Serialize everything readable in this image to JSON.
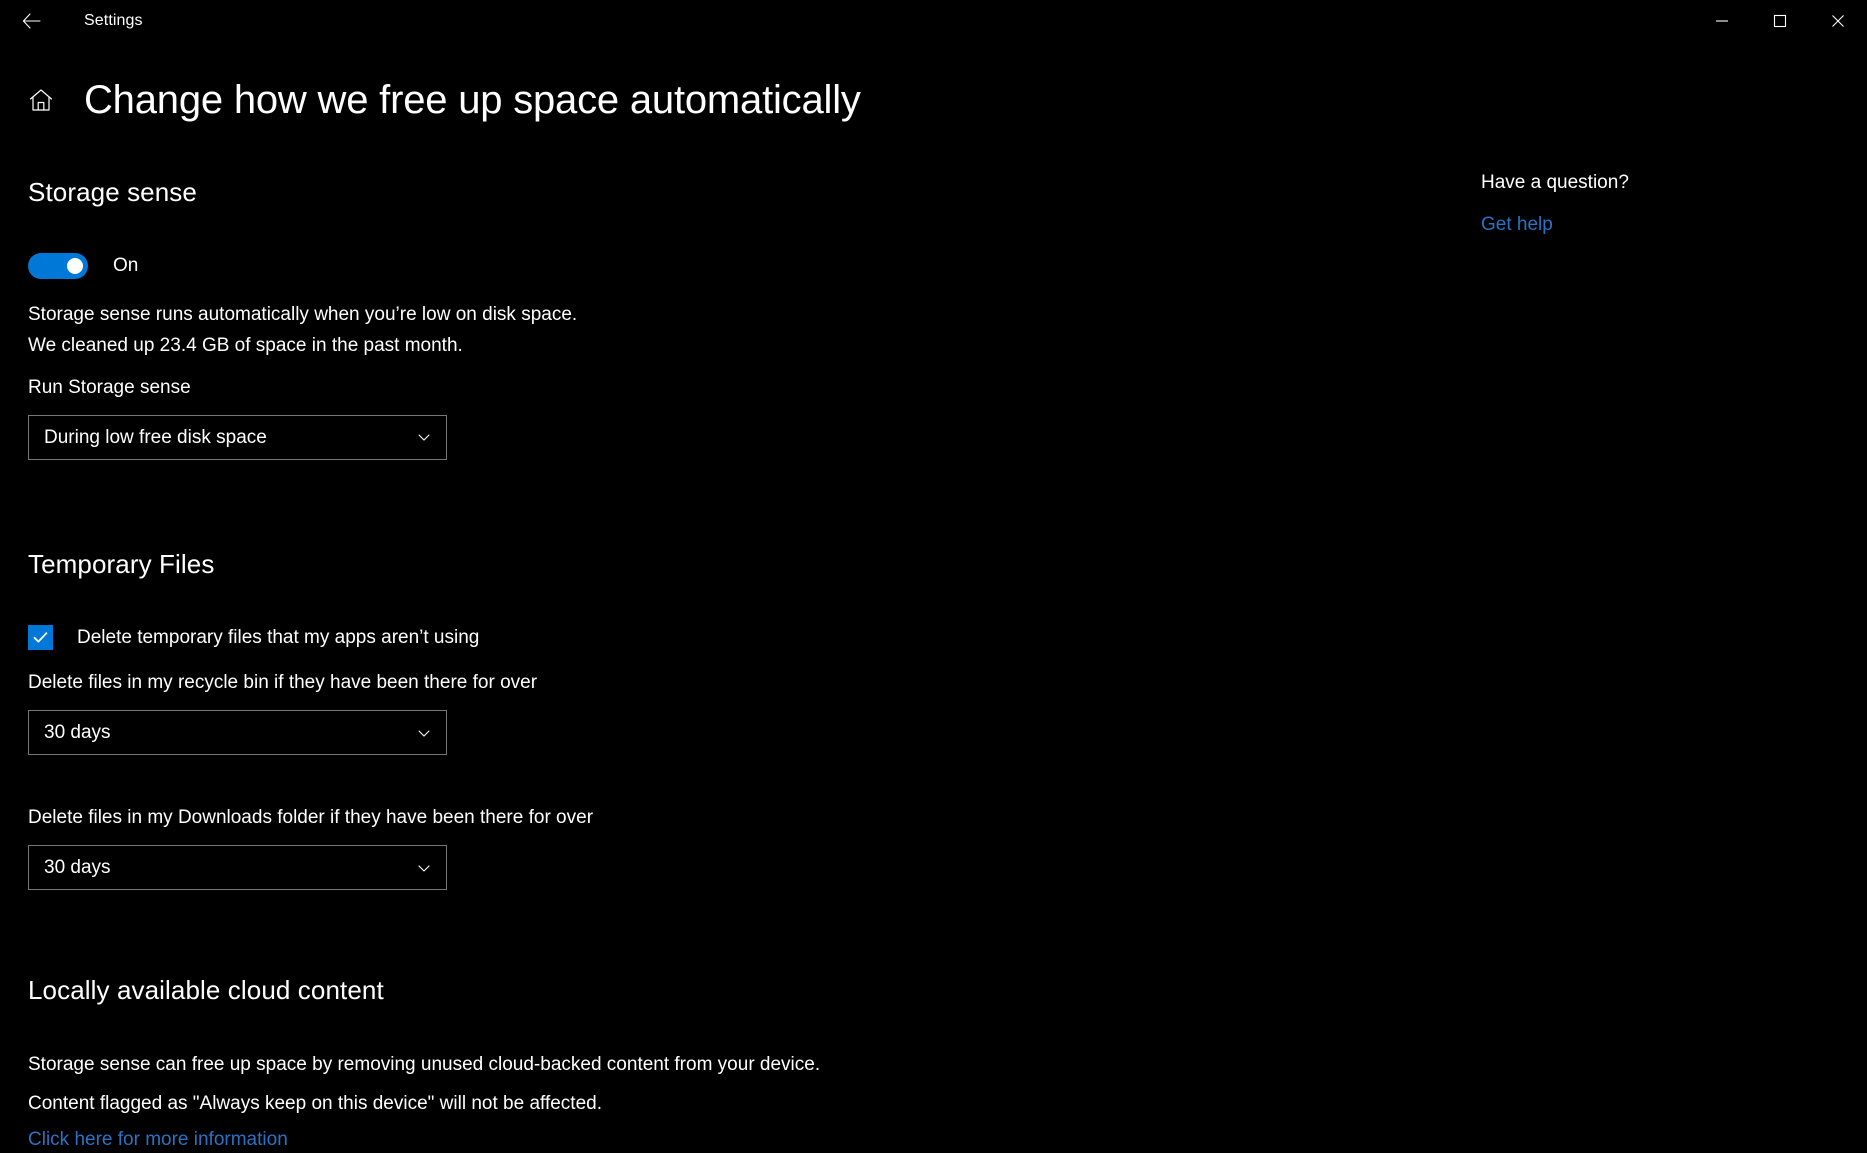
{
  "titlebar": {
    "back_icon": "back-arrow-icon",
    "app_title": "Settings",
    "minimize_label": "—",
    "maximize_label": "□",
    "close_label": "✕"
  },
  "header": {
    "home_icon": "home-icon",
    "page_title": "Change how we free up space automatically"
  },
  "storage_sense": {
    "heading": "Storage sense",
    "toggle_state": "On",
    "toggle_on": true,
    "description_line1": "Storage sense runs automatically when you’re low on disk space.",
    "description_line2": "We cleaned up 23.4 GB of space in the past month.",
    "run_label": "Run Storage sense",
    "run_value": "During low free disk space"
  },
  "temporary_files": {
    "heading": "Temporary Files",
    "checkbox_label": "Delete temporary files that my apps aren’t using",
    "checkbox_checked": true,
    "recycle_label": "Delete files in my recycle bin if they have been there for over",
    "recycle_value": "30 days",
    "downloads_label": "Delete files in my Downloads folder if they have been there for over",
    "downloads_value": "30 days"
  },
  "cloud_content": {
    "heading": "Locally available cloud content",
    "line1": "Storage sense can free up space by removing unused cloud-backed content from your device.",
    "line2": "Content flagged as \"Always keep on this device\" will not be affected.",
    "link": "Click here for more information"
  },
  "right_rail": {
    "heading": "Have a question?",
    "link": "Get help"
  },
  "colors": {
    "background": "#000000",
    "accent": "#0078d7",
    "link": "#2a72c4",
    "border": "#767676",
    "text": "#ffffff"
  }
}
